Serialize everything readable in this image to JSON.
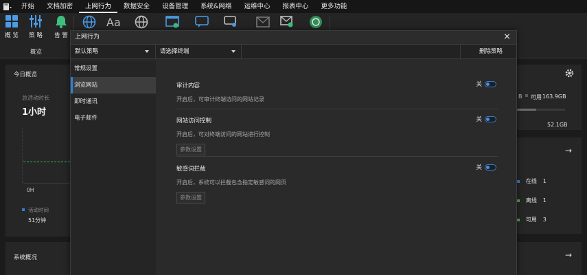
{
  "menubar": {
    "items": [
      "开始",
      "文档加密",
      "上网行为",
      "数据安全",
      "设备管理",
      "系统&网络",
      "运维中心",
      "报表中心",
      "更多功能"
    ],
    "active_index": 2
  },
  "ribbon": {
    "tools": [
      {
        "icon": "grid-icon",
        "label": "概 览"
      },
      {
        "icon": "sliders-icon",
        "label": "策 略"
      },
      {
        "icon": "bell-icon",
        "label": "告 警"
      }
    ],
    "group_label": "概览",
    "hidden_text": "Aa"
  },
  "dashboard": {
    "today_title": "今日概览",
    "active_time_label": "总活动时长",
    "active_time_value": "1小时",
    "axis_zero": "0H",
    "legend_label": "活动时间",
    "legend_value": "51分钟",
    "storage": {
      "used_partial": "B",
      "available_label": "可用",
      "available_value": "163.9GB",
      "second_value": "52.1GB",
      "progress": 0.4
    },
    "status": [
      {
        "label": "在线",
        "value": "1",
        "color": "#3b82c4"
      },
      {
        "label": "离线",
        "value": "1",
        "color": "#5fa85f"
      },
      {
        "label": "可用",
        "value": "3",
        "color": "#5fa85f"
      }
    ],
    "system_title": "系统概况",
    "accent": "#2f7fd6"
  },
  "dialog": {
    "title": "上网行为",
    "close": "×",
    "toolbar": {
      "policy_select": "默认策略",
      "terminal_select": "请选择终端",
      "delete_policy": "删除策略"
    },
    "sidebar": [
      "常规设置",
      "浏览网站",
      "即时通讯",
      "电子邮件"
    ],
    "active_sidebar_index": 1,
    "sections": [
      {
        "title": "审计内容",
        "toggle_label": "关",
        "desc": "开启后，可审计终端访问的网站记录",
        "button": ""
      },
      {
        "title": "网站访问控制",
        "toggle_label": "关",
        "desc": "开启后，可对终端访问的网站进行控制",
        "button": "参数设置"
      },
      {
        "title": "敏感词拦截",
        "toggle_label": "关",
        "desc": "开启后，系统可以拦截包含指定敏感词的网页",
        "button": "参数设置"
      }
    ]
  }
}
